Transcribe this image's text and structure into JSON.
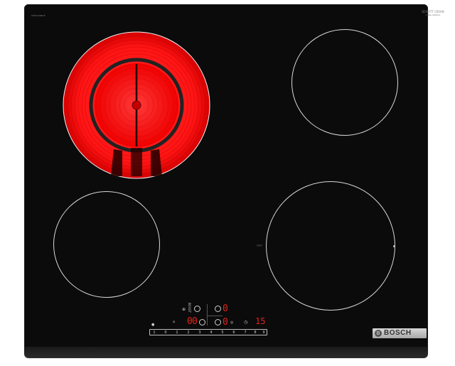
{
  "hob": {
    "model_code": "PKN645BB2E",
    "glass_brand": "SCHOTT CERAN",
    "glass_brand_sub": "Glass ceramic",
    "brand": "BOSCH",
    "brand_mark": "B",
    "colors": {
      "glass": "#0b0b0b",
      "ring": "#d9d9d9",
      "glow": "#ff1a1a",
      "display": "#e2231a"
    }
  },
  "zones": {
    "front_right_label": "○○○"
  },
  "panel": {
    "left_top_display": "0",
    "left_mid_display": "0",
    "right_top_display": "0",
    "right_mid_display": "0",
    "timer_display": "15",
    "lock_icon": "lock-icon",
    "wipe_label": "",
    "power_icon": "power-icon",
    "slider_values": [
      "0",
      "1",
      "2",
      "3",
      "4",
      "5",
      "6",
      "7",
      "8",
      "9"
    ],
    "slider_prefix": "1"
  }
}
